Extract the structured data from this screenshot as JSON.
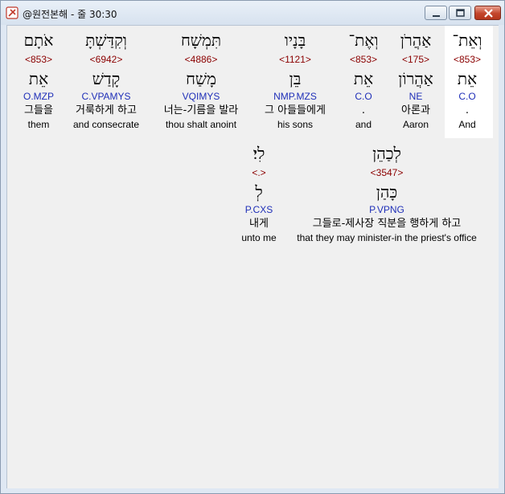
{
  "window": {
    "title": "@원전본해 - 줄 30:30"
  },
  "colors": {
    "strong": "#8b0000",
    "morph": "#1f2fb8",
    "highlight": "#ffffff"
  },
  "words": [
    {
      "heb": "וְאֵת־",
      "strong": "<853>",
      "lemma": "אֵת",
      "morph": "C.O",
      "kor": ".",
      "eng": "And"
    },
    {
      "heb": "אַהֲרֹן",
      "strong": "<175>",
      "lemma": "אַהֲרוֹן",
      "morph": "NE",
      "kor": "아론과",
      "eng": "Aaron"
    },
    {
      "heb": "וְאֶת־",
      "strong": "<853>",
      "lemma": "אֵת",
      "morph": "C.O",
      "kor": ".",
      "eng": "and"
    },
    {
      "heb": "בָּנָיו",
      "strong": "<1121>",
      "lemma": "בֵּן",
      "morph": "NMP.MZS",
      "kor": "그 아들들에게",
      "eng": "his sons"
    },
    {
      "heb": "תִּמְשָׁח",
      "strong": "<4886>",
      "lemma": "מָשַׁח",
      "morph": "VQIMYS",
      "kor": "너는-기름을 발라",
      "eng": "thou shalt anoint"
    },
    {
      "heb": "וְקִדַּשְׁתָּ",
      "strong": "<6942>",
      "lemma": "קָדַשׁ",
      "morph": "C.VPAMYS",
      "kor": "거룩하게 하고",
      "eng": "and consecrate"
    },
    {
      "heb": "אֹתָם",
      "strong": "<853>",
      "lemma": "אֵת",
      "morph": "O.MZP",
      "kor": "그들을",
      "eng": "them"
    },
    {
      "heb": "לְכַהֵן",
      "strong": "<3547>",
      "lemma": "כָּהַן",
      "morph": "P.VPNG",
      "kor": "그들로-제사장 직분을 행하게 하고",
      "eng": "that they may minister-in the priest's office"
    },
    {
      "heb": "לִי׃",
      "strong": "<.>",
      "lemma": "לְ",
      "morph": "P.CXS",
      "kor": "내게",
      "eng": "unto me"
    }
  ]
}
